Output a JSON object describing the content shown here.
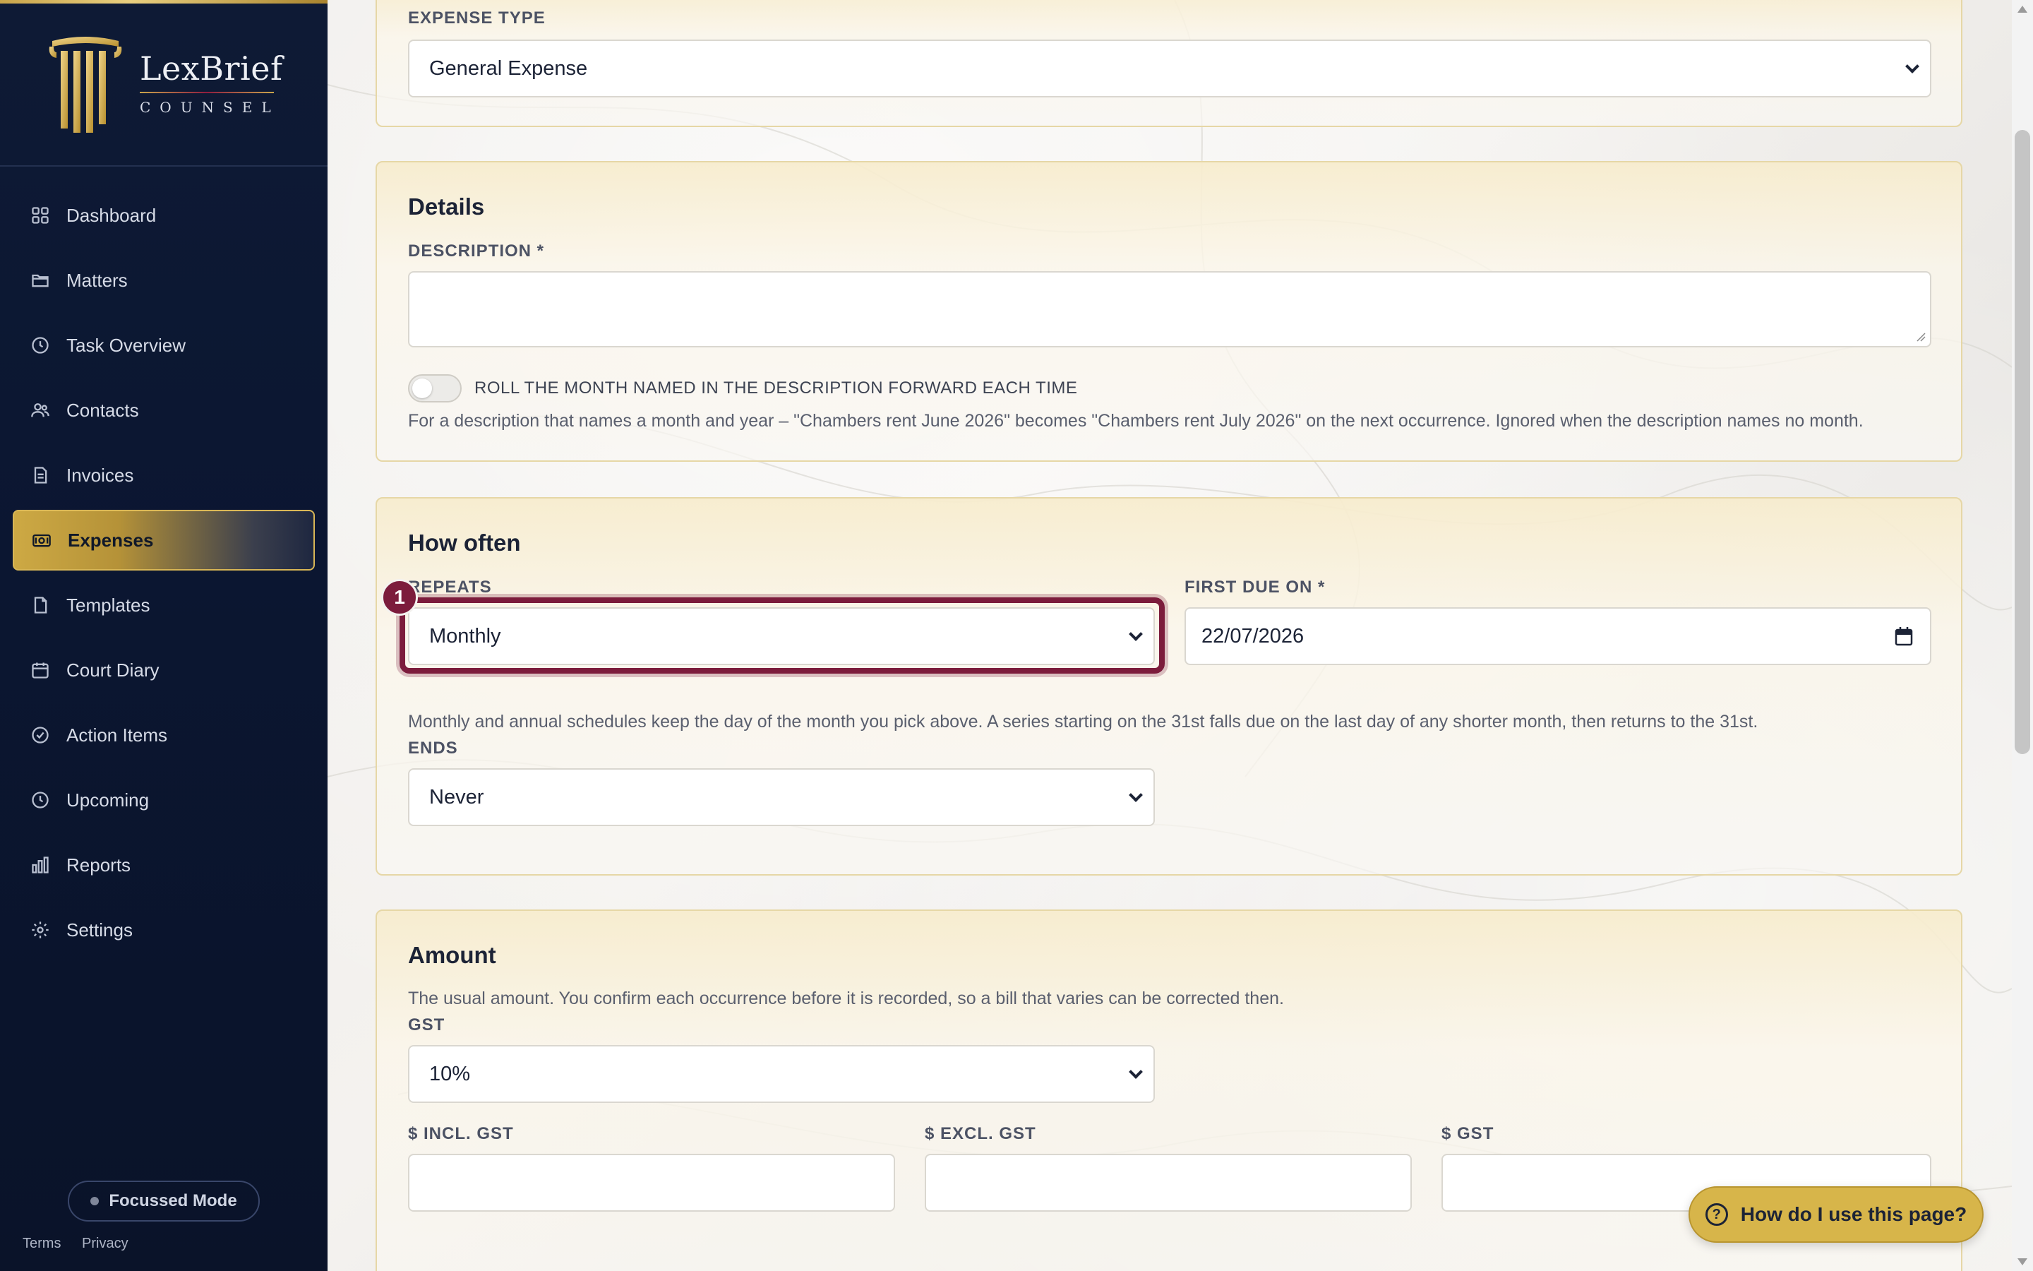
{
  "brand": {
    "name": "LexBrief",
    "sub": "COUNSEL"
  },
  "nav": [
    {
      "label": "Dashboard",
      "icon": "grid-icon"
    },
    {
      "label": "Matters",
      "icon": "folder-icon"
    },
    {
      "label": "Task Overview",
      "icon": "clock-icon"
    },
    {
      "label": "Contacts",
      "icon": "users-icon"
    },
    {
      "label": "Invoices",
      "icon": "document-icon"
    },
    {
      "label": "Expenses",
      "icon": "money-icon",
      "active": true
    },
    {
      "label": "Templates",
      "icon": "file-icon"
    },
    {
      "label": "Court Diary",
      "icon": "calendar-icon"
    },
    {
      "label": "Action Items",
      "icon": "check-circle-icon"
    },
    {
      "label": "Upcoming",
      "icon": "clock-icon"
    },
    {
      "label": "Reports",
      "icon": "bar-chart-icon"
    },
    {
      "label": "Settings",
      "icon": "gear-icon"
    }
  ],
  "sidebar_footer": {
    "focus_mode": "Focussed Mode",
    "terms": "Terms",
    "privacy": "Privacy"
  },
  "expense_type": {
    "label": "EXPENSE TYPE",
    "value": "General Expense"
  },
  "details": {
    "title": "Details",
    "description_label": "DESCRIPTION *",
    "description_value": "",
    "roll_toggle_label": "ROLL THE MONTH NAMED IN THE DESCRIPTION FORWARD EACH TIME",
    "roll_toggle_on": false,
    "roll_help": "For a description that names a month and year – \"Chambers rent June 2026\" becomes \"Chambers rent July 2026\" on the next occurrence. Ignored when the description names no month."
  },
  "how_often": {
    "title": "How often",
    "repeats_label": "REPEATS",
    "repeats_value": "Monthly",
    "first_due_label": "FIRST DUE ON *",
    "first_due_value": "22/07/2026",
    "schedule_help": "Monthly and annual schedules keep the day of the month you pick above. A series starting on the 31st falls due on the last day of any shorter month, then returns to the 31st.",
    "ends_label": "ENDS",
    "ends_value": "Never"
  },
  "amount": {
    "title": "Amount",
    "help": "The usual amount. You confirm each occurrence before it is recorded, so a bill that varies can be corrected then.",
    "gst_label": "GST",
    "gst_value": "10%",
    "incl_label": "$ INCL. GST",
    "excl_label": "$ EXCL. GST",
    "gst_amount_label": "$ GST",
    "incl_value": "",
    "excl_value": "",
    "gst_amount_value": ""
  },
  "annotation": {
    "badge": "1"
  },
  "help_button": "How do I use this page?",
  "colors": {
    "sidebar": "#0e1a35",
    "accent_gold": "#d7b54a",
    "highlight": "#7c1c3c"
  }
}
